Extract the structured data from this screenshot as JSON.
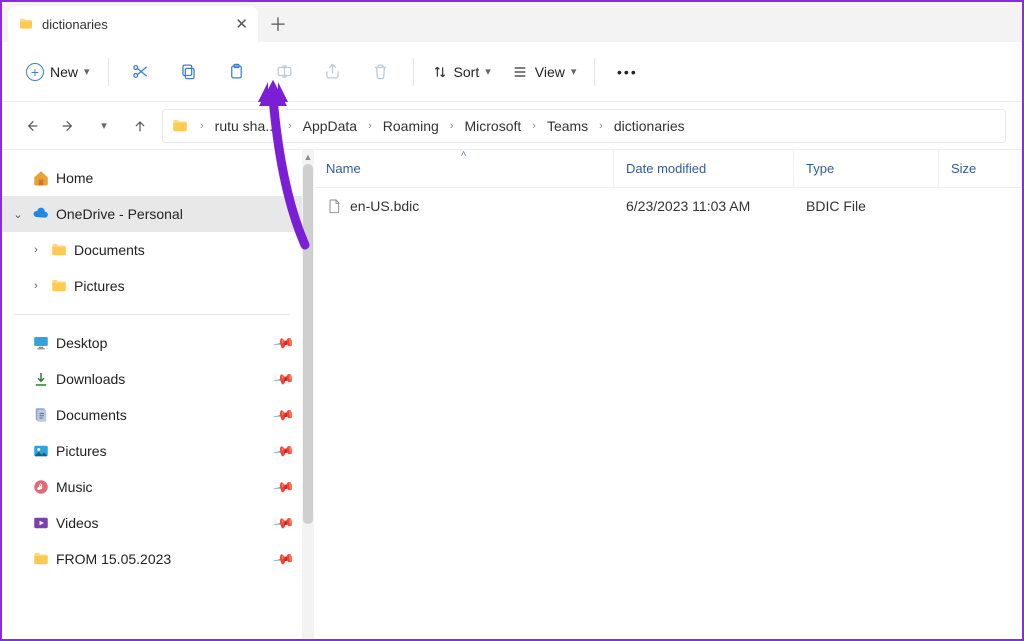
{
  "tab": {
    "title": "dictionaries"
  },
  "toolbar": {
    "new_label": "New",
    "sort_label": "Sort",
    "view_label": "View"
  },
  "breadcrumbs": {
    "items": [
      "rutu sha...",
      "AppData",
      "Roaming",
      "Microsoft",
      "Teams",
      "dictionaries"
    ]
  },
  "sidebar": {
    "home_label": "Home",
    "onedrive_label": "OneDrive - Personal",
    "onedrive_children": [
      {
        "label": "Documents"
      },
      {
        "label": "Pictures"
      }
    ],
    "quick": [
      {
        "label": "Desktop",
        "icon": "desktop"
      },
      {
        "label": "Downloads",
        "icon": "downloads"
      },
      {
        "label": "Documents",
        "icon": "documents"
      },
      {
        "label": "Pictures",
        "icon": "pictures"
      },
      {
        "label": "Music",
        "icon": "music"
      },
      {
        "label": "Videos",
        "icon": "videos"
      },
      {
        "label": "FROM 15.05.2023",
        "icon": "folder"
      }
    ]
  },
  "columns": {
    "name": "Name",
    "date": "Date modified",
    "type": "Type",
    "size": "Size"
  },
  "files": [
    {
      "name": "en-US.bdic",
      "date": "6/23/2023 11:03 AM",
      "type": "BDIC File",
      "size": ""
    }
  ],
  "annotation": {
    "target": "paste-button"
  }
}
